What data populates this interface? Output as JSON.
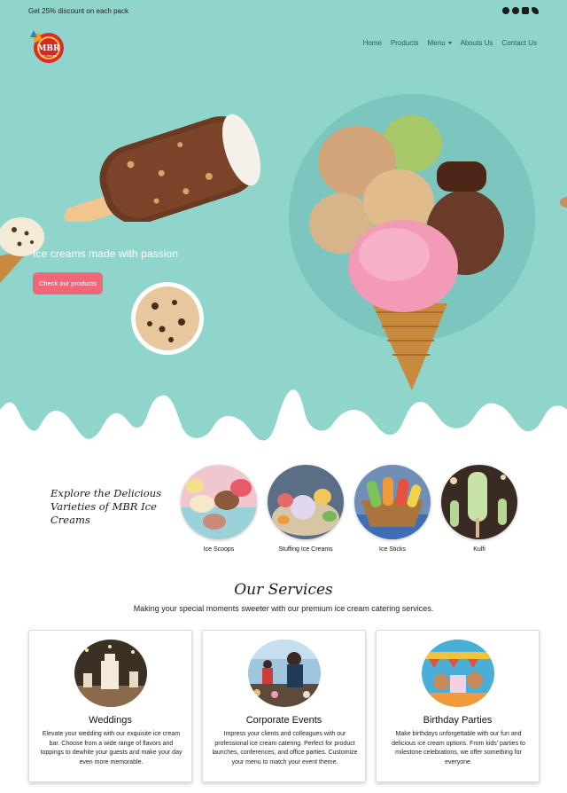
{
  "topbar": {
    "promo_text": "Get 25% discount on each pack"
  },
  "socials": [
    "whatsapp-icon",
    "facebook-icon",
    "instagram-icon",
    "twitter-icon"
  ],
  "logo": {
    "text": "MBR",
    "sub": "ICE CREAMS"
  },
  "nav": {
    "home": "Home",
    "products": "Products",
    "menu": "Menu",
    "about": "Abouts Us",
    "contact": "Contact Us"
  },
  "hero": {
    "title": "Ice creams made with passion",
    "cta": "Check our products"
  },
  "varieties": {
    "heading": "Explore the Delicious Varieties of MBR Ice Creams",
    "items": [
      "Ice Scoops",
      "Stuffing Ice Creams",
      "Ice Sticks",
      "Kulfi"
    ]
  },
  "services": {
    "title": "Our Services",
    "subtitle": "Making your special moments sweeter with our premium ice cream catering services.",
    "cards": [
      {
        "title": "Weddings",
        "desc": "Elevate your wedding with our exquisite ice cream bar. Choose from a wide range of flavors and toppings to dewhite your guests and make your day even more memorable."
      },
      {
        "title": "Corporate Events",
        "desc": "Impress your clients and colleagues with our professional ice cream catering. Perfect for product launches, conferences, and office parties. Customize your menu to match your event theme."
      },
      {
        "title": "Birthday Parties",
        "desc": "Make birthdays unforgettable with our fun and delicious ice cream options. From kids' parties to milestone celebrations, we offer something for everyone."
      }
    ]
  },
  "colors": {
    "hero_bg": "#8fd5cc",
    "halo": "#7cc6bf",
    "cta": "#f0677a",
    "white": "#ffffff"
  }
}
